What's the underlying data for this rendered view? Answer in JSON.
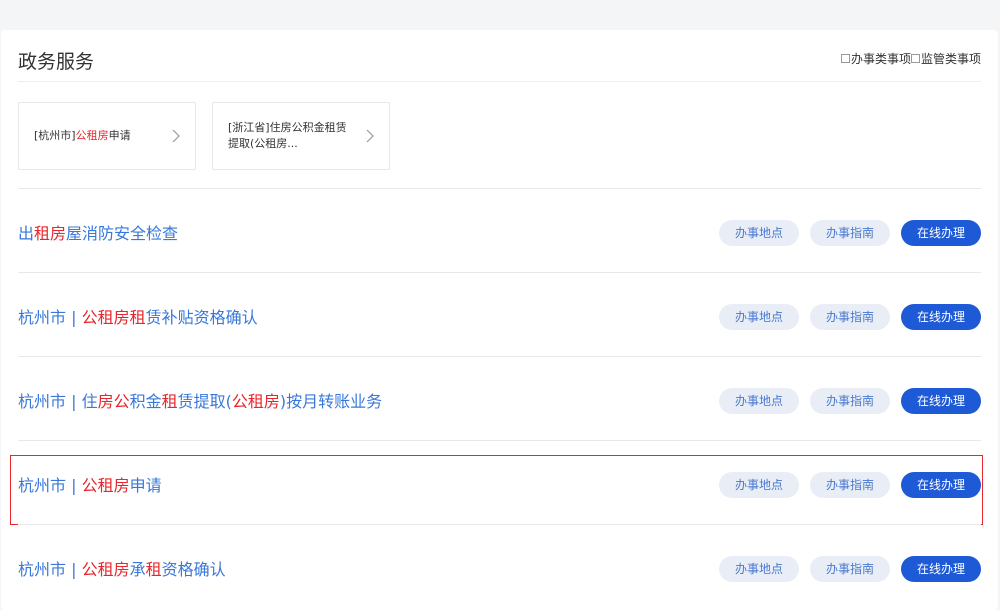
{
  "header": {
    "title": "政务服务",
    "filters": [
      "办事类事项",
      "监管类事项"
    ]
  },
  "cards": [
    {
      "segments": [
        {
          "text": "[杭州市]",
          "hl": false
        },
        {
          "text": "公租房",
          "hl": true
        },
        {
          "text": "申请",
          "hl": false
        }
      ]
    },
    {
      "segments": [
        {
          "text": "[浙江省]住房公积金租赁提取(公租房...",
          "hl": false
        }
      ]
    }
  ],
  "actions": {
    "location": "办事地点",
    "guide": "办事指南",
    "online": "在线办理"
  },
  "rows": [
    {
      "segments": [
        {
          "text": "出",
          "hl": false
        },
        {
          "text": "租",
          "hl": true
        },
        {
          "text": "房",
          "hl": true
        },
        {
          "text": "屋消防安全检查",
          "hl": false
        }
      ]
    },
    {
      "segments": [
        {
          "text": "杭州市 | ",
          "hl": false
        },
        {
          "text": "公租房",
          "hl": true
        },
        {
          "text": "租",
          "hl": true
        },
        {
          "text": "赁补贴资格确认",
          "hl": false
        }
      ]
    },
    {
      "segments": [
        {
          "text": "杭州市 | 住",
          "hl": false
        },
        {
          "text": "房",
          "hl": true
        },
        {
          "text": "公",
          "hl": true
        },
        {
          "text": "积金",
          "hl": false
        },
        {
          "text": "租",
          "hl": true
        },
        {
          "text": "赁提取(",
          "hl": false
        },
        {
          "text": "公租房",
          "hl": true
        },
        {
          "text": ")按月转账业务",
          "hl": false
        }
      ]
    },
    {
      "segments": [
        {
          "text": "杭州市 | ",
          "hl": false
        },
        {
          "text": "公租房",
          "hl": true
        },
        {
          "text": "申请",
          "hl": false
        }
      ],
      "selected": true
    },
    {
      "segments": [
        {
          "text": "杭州市 | ",
          "hl": false
        },
        {
          "text": "公租房",
          "hl": true
        },
        {
          "text": "承",
          "hl": false
        },
        {
          "text": "租",
          "hl": true
        },
        {
          "text": "资格确认",
          "hl": false
        }
      ]
    }
  ],
  "colors": {
    "link": "#3878d9",
    "highlight": "#e8262c",
    "primary_button": "#1f5ad6"
  }
}
